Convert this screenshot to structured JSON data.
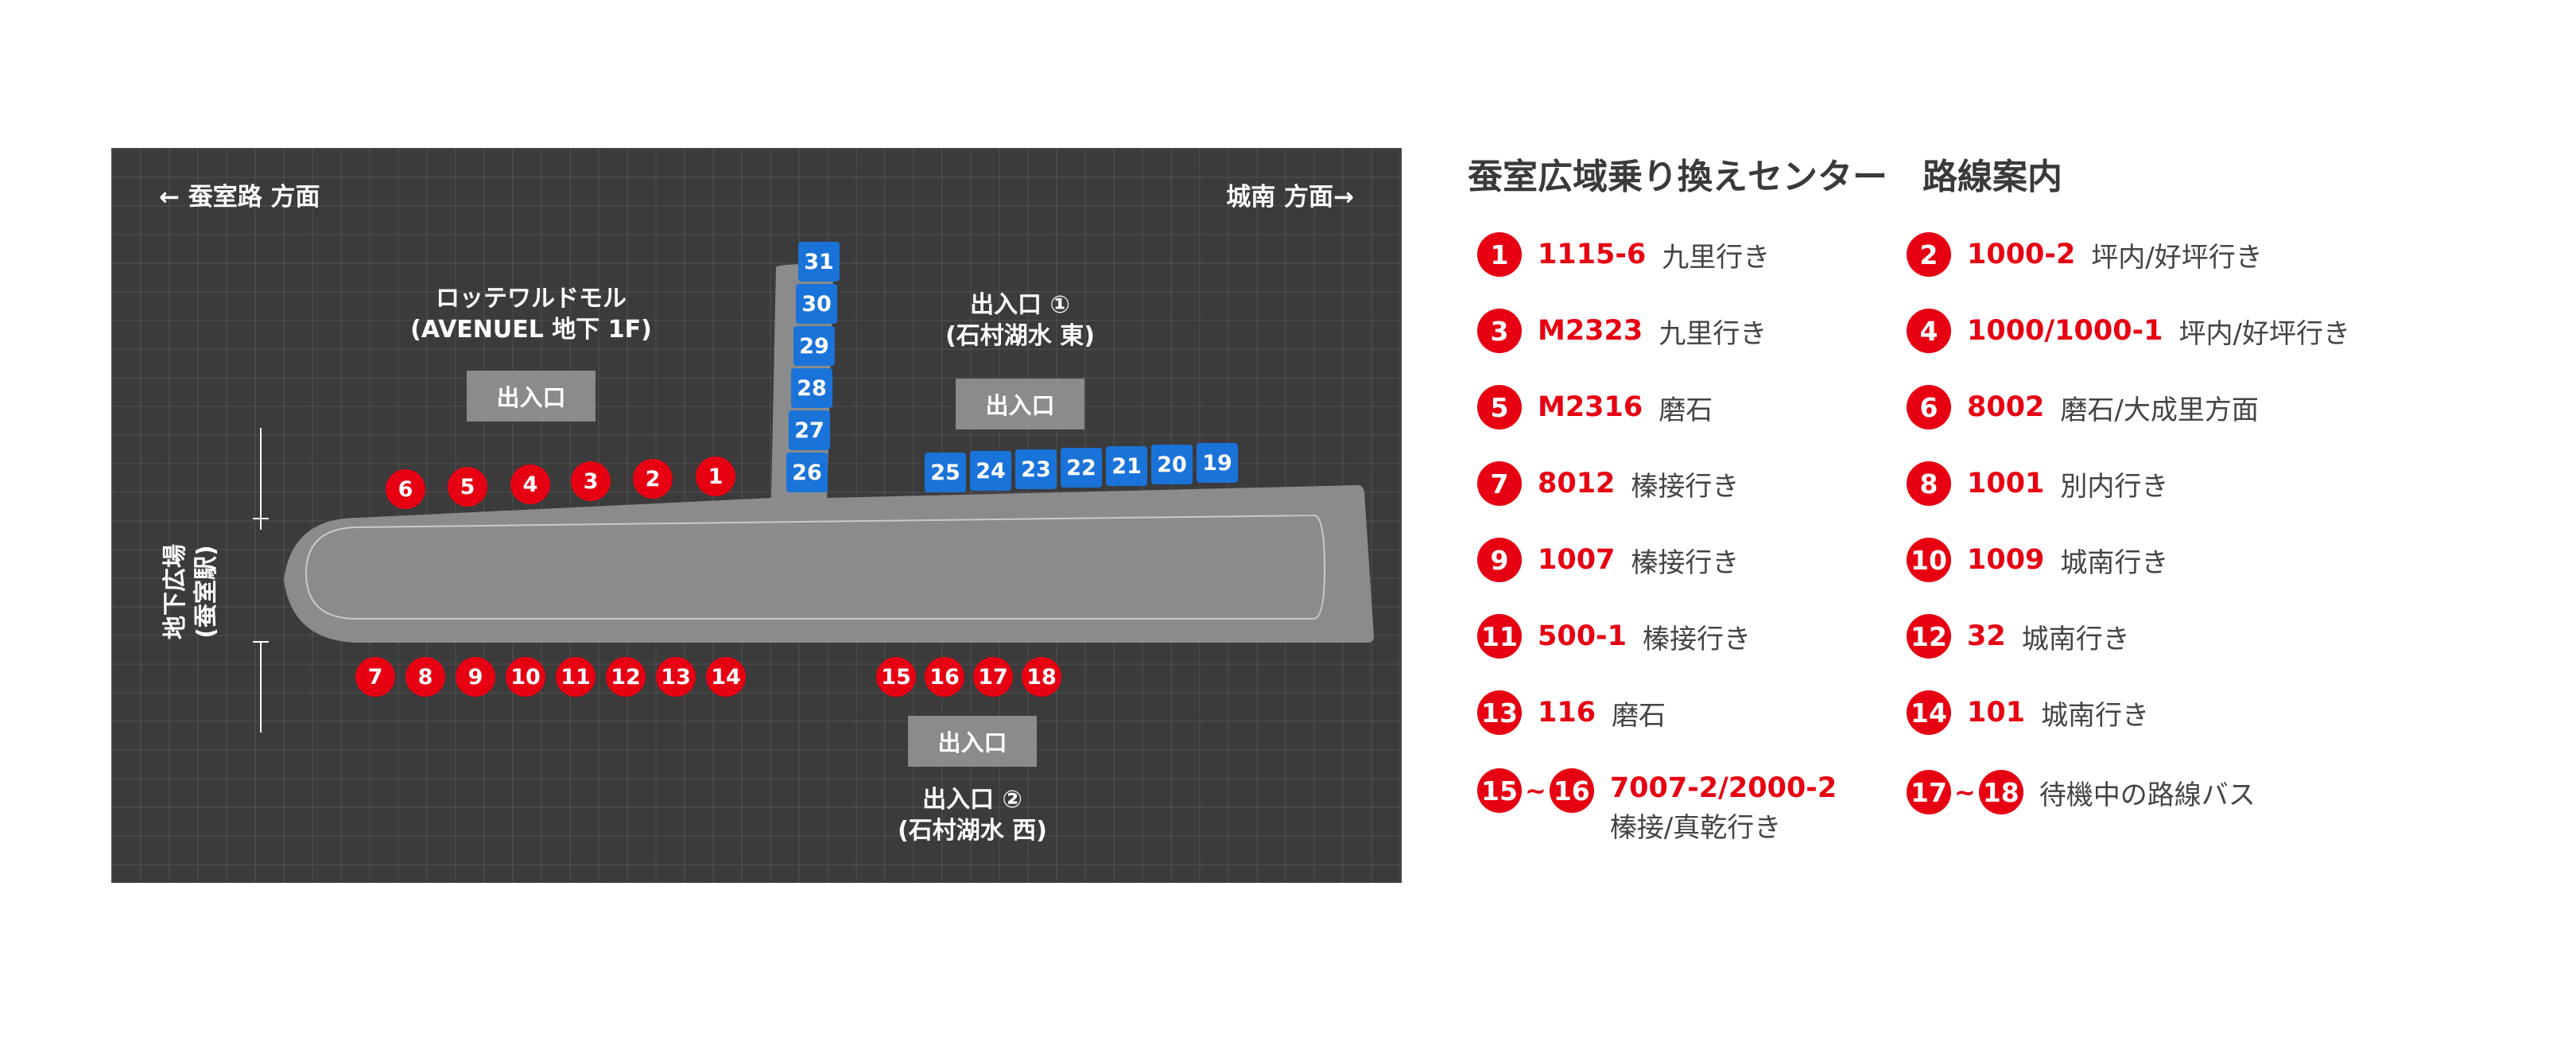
{
  "map": {
    "dir_left": "← 蚕室路 方面",
    "dir_right": "城南 方面→",
    "mall_name": "ロッテワルドモル",
    "mall_sub": "(AVENUEL 地下 1F)",
    "mall_exit": "出入口",
    "exit1_title": "出入口 ①",
    "exit1_sub": "(石村湖水 東)",
    "exit1_box": "出入口",
    "exit2_box": "出入口",
    "exit2_title": "出入口 ②",
    "exit2_sub": "(石村湖水 西)",
    "side_line1": "地下広場",
    "side_line2": "(蚕室駅)",
    "top_red_stops": [
      "6",
      "5",
      "4",
      "3",
      "2",
      "1"
    ],
    "bottom_left_stops": [
      "7",
      "8",
      "9",
      "10",
      "11",
      "12",
      "13",
      "14"
    ],
    "bottom_right_stops": [
      "15",
      "16",
      "17",
      "18"
    ],
    "blue_vertical_stops": [
      "31",
      "30",
      "29",
      "28",
      "27",
      "26"
    ],
    "blue_horizontal_stops": [
      "25",
      "24",
      "23",
      "22",
      "21",
      "20",
      "19"
    ],
    "colors": {
      "red": "#e60012",
      "blue": "#1a73d9",
      "platform": "#8b8b8b",
      "background": "#3b3b3b"
    }
  },
  "legend": {
    "title": "蚕室広域乗り換えセンター　路線案内",
    "entries": [
      {
        "badge": "1",
        "route": "1115-6",
        "dest": "九里行き"
      },
      {
        "badge": "2",
        "route": "1000-2",
        "dest": "坪内/好坪行き"
      },
      {
        "badge": "3",
        "route": "M2323",
        "dest": "九里行き"
      },
      {
        "badge": "4",
        "route": "1000/1000-1",
        "dest": "坪内/好坪行き"
      },
      {
        "badge": "5",
        "route": "M2316",
        "dest": "磨石"
      },
      {
        "badge": "6",
        "route": "8002",
        "dest": "磨石/大成里方面"
      },
      {
        "badge": "7",
        "route": "8012",
        "dest": "榛接行き"
      },
      {
        "badge": "8",
        "route": "1001",
        "dest": "別内行き"
      },
      {
        "badge": "9",
        "route": "1007",
        "dest": "榛接行き"
      },
      {
        "badge": "10",
        "route": "1009",
        "dest": "城南行き"
      },
      {
        "badge": "11",
        "route": "500-1",
        "dest": "榛接行き"
      },
      {
        "badge": "12",
        "route": "32",
        "dest": "城南行き"
      },
      {
        "badge": "13",
        "route": "116",
        "dest": "磨石"
      },
      {
        "badge": "14",
        "route": "101",
        "dest": "城南行き"
      }
    ],
    "range_a": {
      "from": "15",
      "tilde": "~",
      "to": "16",
      "route": "7007-2/2000-2",
      "dest": "榛接/真乾行き"
    },
    "range_b": {
      "from": "17",
      "tilde": "~",
      "to": "18",
      "dest": "待機中の路線バス"
    }
  }
}
